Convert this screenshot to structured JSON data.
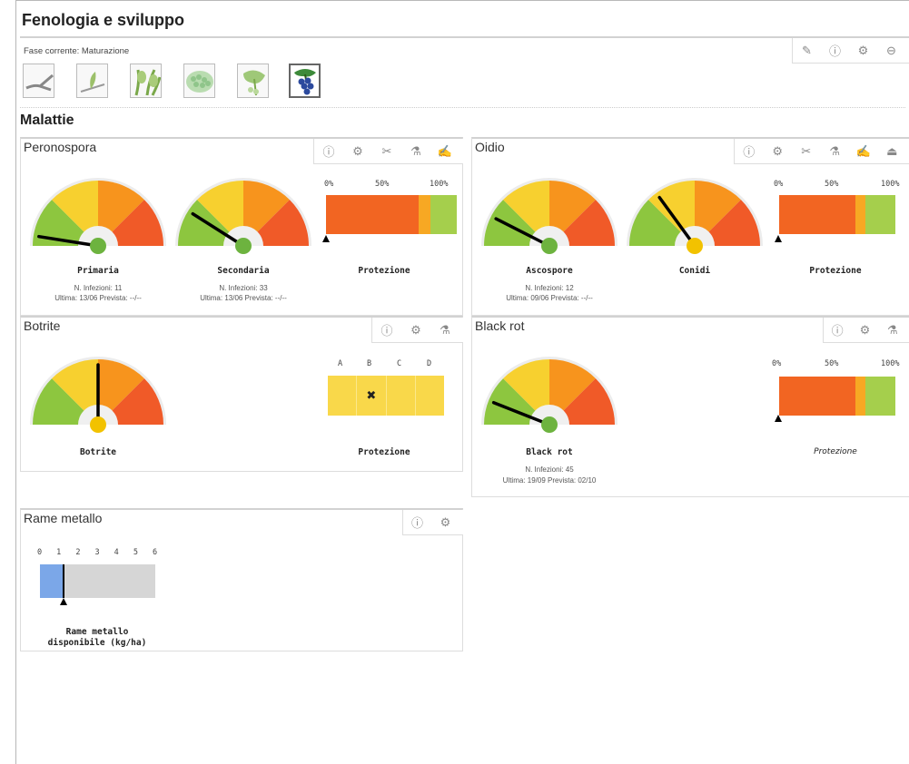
{
  "header": {
    "title": "Fenologia e sviluppo"
  },
  "phenology": {
    "current_phase": "Fase corrente: Maturazione",
    "toolbar_icons": [
      "pencil-icon",
      "info-icon",
      "gear-icon",
      "minus-circle-icon"
    ],
    "phases": [
      {
        "name": "phase-dormancy-icon",
        "selected": false
      },
      {
        "name": "phase-budbreak-icon",
        "selected": false
      },
      {
        "name": "phase-leaves-icon",
        "selected": false
      },
      {
        "name": "phase-flowering-icon",
        "selected": false
      },
      {
        "name": "phase-fruitset-icon",
        "selected": false
      },
      {
        "name": "phase-ripening-icon",
        "selected": true
      }
    ]
  },
  "diseases": {
    "title": "Malattie",
    "peronospora": {
      "title": "Peronospora",
      "g1": {
        "label": "Primaria",
        "level": 0.05,
        "infections": "N. Infezioni: 11",
        "dates": "Ultima: 13/06 Prevista: --/--"
      },
      "g2": {
        "label": "Secondaria",
        "level": 0.18,
        "infections": "N. Infezioni: 33",
        "dates": "Ultima: 13/06 Prevista: --/--"
      },
      "protection": {
        "label": "Protezione",
        "scale": [
          "0%",
          "50%",
          "100%"
        ],
        "segments": [
          0.78,
          0.1,
          0.22
        ],
        "marker": 0.0
      }
    },
    "oidio": {
      "title": "Oidio",
      "g1": {
        "label": "Ascospore",
        "level": 0.15,
        "infections": "N. Infezioni: 12",
        "dates": "Ultima: 09/06 Prevista: --/--"
      },
      "g2": {
        "label": "Conidi",
        "level": 0.3,
        "infections": "",
        "dates": ""
      },
      "protection": {
        "label": "Protezione",
        "scale": [
          "0%",
          "50%",
          "100%"
        ],
        "segments": [
          0.72,
          0.1,
          0.28
        ],
        "marker": 0.0
      }
    },
    "botrite": {
      "title": "Botrite",
      "g1": {
        "label": "Botrite",
        "level": 0.5
      },
      "protection": {
        "label": "Protezione",
        "columns": [
          "A",
          "B",
          "C",
          "D"
        ],
        "mark": "✖"
      }
    },
    "blackrot": {
      "title": "Black rot",
      "g1": {
        "label": "Black rot",
        "level": 0.12,
        "infections": "N. Infezioni: 45",
        "dates": "Ultima: 19/09 Prevista: 02/10"
      },
      "protection": {
        "label": "Protezione",
        "scale": [
          "0%",
          "50%",
          "100%"
        ],
        "segments": [
          0.72,
          0.1,
          0.28
        ],
        "marker": 0.0
      }
    },
    "rame": {
      "title": "Rame metallo",
      "scale": [
        "0",
        "1",
        "2",
        "3",
        "4",
        "5",
        "6"
      ],
      "value": 1.2,
      "max": 6,
      "label_line1": "Rame metallo",
      "label_line2": "disponibile (kg/ha)"
    }
  },
  "colors": {
    "green": "#8dc63f",
    "yellow": "#f7d02f",
    "orange": "#f7941d",
    "red": "#f05a28",
    "needle": "#000",
    "hub_green": "#6db33f",
    "hub_yellow": "#f2c200",
    "bar_orange": "#f26522",
    "bar_mid": "#f7a823",
    "bar_green": "#a5cf4c",
    "rame": "#7ba7e8",
    "rame_bg": "#d6d6d6",
    "bot_yellow": "#f9d84a"
  }
}
